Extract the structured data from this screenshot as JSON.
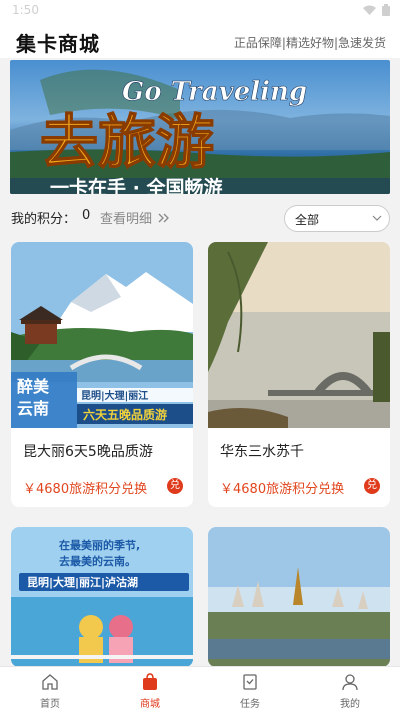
{
  "status_bar": {
    "time": "1:50"
  },
  "header": {
    "title": "集卡商城",
    "slogan": "正品保障|精选好物|急速发货"
  },
  "banner": {
    "headline_en": "Go Traveling",
    "headline_cn": "去旅游",
    "subline": "一卡在手 · 全国畅游"
  },
  "points": {
    "label": "我的积分：",
    "value": "0",
    "detail_link": "查看明细"
  },
  "filter": {
    "selected": "全部"
  },
  "products": [
    {
      "title": "昆大丽6天5晚品质游",
      "price": "￥4680旅游积分兑换",
      "badge": "兑",
      "image_text": {
        "left_line1": "醉美",
        "left_line2": "云南",
        "route": "昆明|大理|丽江",
        "tagline": "六天五晚品质游"
      }
    },
    {
      "title": "华东三水苏千",
      "price": "￥4680旅游积分兑换",
      "badge": "兑"
    },
    {
      "title": "",
      "price": "",
      "image_text": {
        "line1": "在最美丽的季节,",
        "line2": "去最美的云南。",
        "route": "昆明|大理|丽江|泸沽湖"
      }
    },
    {
      "title": "",
      "price": ""
    }
  ],
  "tabbar": {
    "items": [
      {
        "label": "首页",
        "icon": "home-icon"
      },
      {
        "label": "商城",
        "icon": "shop-bag-icon",
        "active": true
      },
      {
        "label": "任务",
        "icon": "task-icon"
      },
      {
        "label": "我的",
        "icon": "profile-icon"
      }
    ]
  },
  "colors": {
    "accent": "#e03a1c",
    "price": "#e1471f"
  }
}
